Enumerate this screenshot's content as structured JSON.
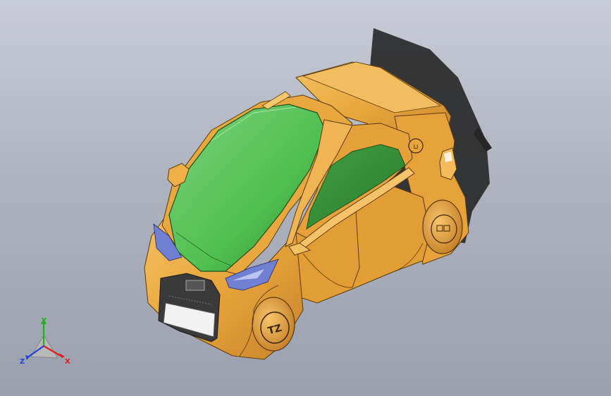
{
  "viewport": {
    "background_top": "#c9ccd6",
    "background_bottom": "#9aa0ad"
  },
  "model": {
    "body_color": "#e8a53a",
    "glass_color": "#4fbf4f",
    "accent_color": "#6f7fd1",
    "shadow_color": "#2a2a2a",
    "front_badge": "TZ"
  },
  "triad": {
    "x_label": "X",
    "y_label": "Y",
    "z_label": "Z",
    "x_color": "#e02020",
    "y_color": "#20b020",
    "z_color": "#2040e0"
  }
}
